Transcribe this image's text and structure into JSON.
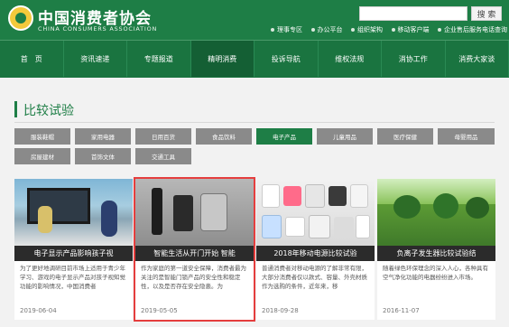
{
  "header": {
    "title": "中国消费者协会",
    "subtitle": "CHINA CONSUMERS ASSOCIATION",
    "search_placeholder": "",
    "search_button": "搜 索",
    "links": [
      "理事专区",
      "办公平台",
      "组织架构",
      "移动客户端",
      "企业售后服务电话查询"
    ]
  },
  "nav": {
    "items": [
      "首　页",
      "资讯速递",
      "专题报道",
      "精明消费",
      "投诉导航",
      "维权法规",
      "消协工作",
      "消费大家谈"
    ],
    "active_index": 3
  },
  "section": {
    "title": "比较试验"
  },
  "tabs": {
    "items": [
      "服装鞋帽",
      "家用电器",
      "日用百货",
      "食品饮料",
      "电子产品",
      "儿童用品",
      "医疗保健",
      "母婴用品",
      "房屋建材",
      "首饰文体",
      "交通工具"
    ],
    "active_index": 4
  },
  "cards": [
    {
      "title": "电子显示产品影响孩子视",
      "desc": "为了更好地调研目前市场上适用于青少年学习、游戏的电子显示产品对孩子视知觉功能的影响情况，中国消费者",
      "date": "2019-06-04",
      "image_icon": "kids-playing-image"
    },
    {
      "title": "智能生活从开门开始 智能",
      "desc": "作为家庭的第一道安全保障，消费者最为关注的是智能门锁产品的安全性和稳定性，以及是否存在安全隐患。为",
      "date": "2019-05-05",
      "image_icon": "smart-lock-image"
    },
    {
      "title": "2018年移动电源比较试验",
      "desc": "普通消费者对移动电源的了解非常有限，大部分消费者仅以款式、容量、外壳材质作为选购的条件，近年来，移",
      "date": "2018-09-28",
      "image_icon": "power-banks-image"
    },
    {
      "title": "负离子发生器比较试验结",
      "desc": "随着绿色环保理念的深入人心，各种具有空气净化功能的电器纷纷进入市场。",
      "date": "2016-11-07",
      "image_icon": "grass-image"
    }
  ]
}
